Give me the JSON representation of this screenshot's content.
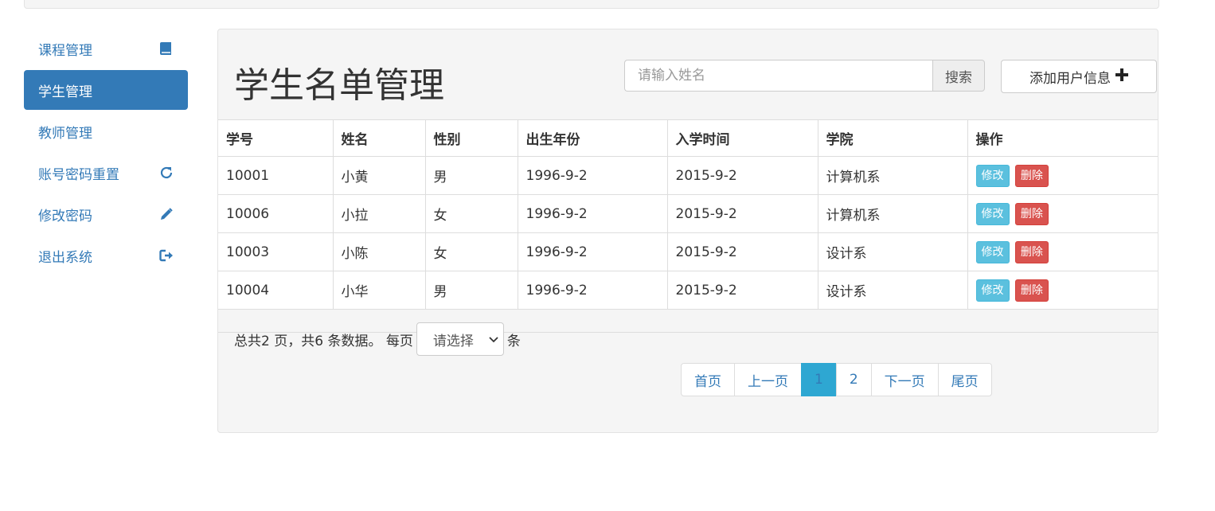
{
  "sidebar": {
    "items": [
      {
        "label": "课程管理",
        "icon": "book-icon"
      },
      {
        "label": "学生管理",
        "icon": ""
      },
      {
        "label": "教师管理",
        "icon": ""
      },
      {
        "label": "账号密码重置",
        "icon": "refresh-icon"
      },
      {
        "label": "修改密码",
        "icon": "pencil-icon"
      },
      {
        "label": "退出系统",
        "icon": "logout-icon"
      }
    ],
    "active_index": 1
  },
  "main": {
    "title": "学生名单管理",
    "search": {
      "placeholder": "请输入姓名",
      "value": "",
      "button_label": "搜索"
    },
    "add_button_label": "添加用户信息",
    "table": {
      "headers": [
        "学号",
        "姓名",
        "性别",
        "出生年份",
        "入学时间",
        "学院",
        "操作"
      ],
      "rows": [
        [
          "10001",
          "小黄",
          "男",
          "1996-9-2",
          "2015-9-2",
          "计算机系"
        ],
        [
          "10006",
          "小拉",
          "女",
          "1996-9-2",
          "2015-9-2",
          "计算机系"
        ],
        [
          "10003",
          "小陈",
          "女",
          "1996-9-2",
          "2015-9-2",
          "设计系"
        ],
        [
          "10004",
          "小华",
          "男",
          "1996-9-2",
          "2015-9-2",
          "设计系"
        ]
      ],
      "edit_label": "修改",
      "delete_label": "删除"
    },
    "summary": {
      "prefix": "总共2 页，共6 条数据。 每页",
      "select_value": "请选择",
      "suffix": "条"
    },
    "pagination": {
      "first": "首页",
      "prev": "上一页",
      "pages": [
        "1",
        "2"
      ],
      "current": "1",
      "next": "下一页",
      "last": "尾页"
    }
  },
  "colors": {
    "primary": "#337ab7",
    "info": "#5bc0de",
    "danger": "#d9534f",
    "pager_active": "#2ea7d2"
  }
}
